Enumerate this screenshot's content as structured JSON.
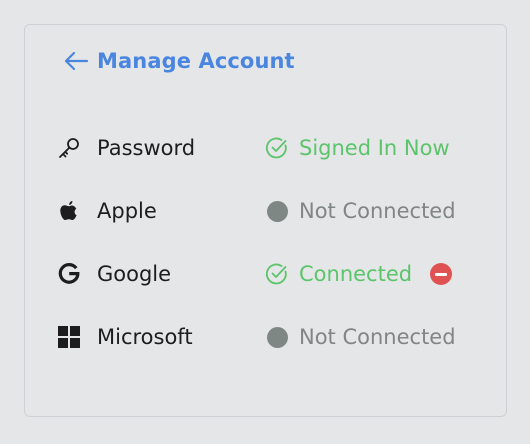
{
  "header": {
    "back_label": "Manage Account"
  },
  "accounts": [
    {
      "provider": "Password",
      "icon": "key-icon",
      "status": "Signed In Now",
      "connected": true
    },
    {
      "provider": "Apple",
      "icon": "apple-logo-icon",
      "status": "Not Connected",
      "connected": false
    },
    {
      "provider": "Google",
      "icon": "google-logo-icon",
      "status": "Connected",
      "connected": true,
      "removable": true
    },
    {
      "provider": "Microsoft",
      "icon": "microsoft-logo-icon",
      "status": "Not Connected",
      "connected": false
    }
  ],
  "colors": {
    "accent": "#4a86e0",
    "connected": "#5cc46a",
    "not_connected": "#808684",
    "remove": "#e05252",
    "background": "#e5e6e8"
  }
}
